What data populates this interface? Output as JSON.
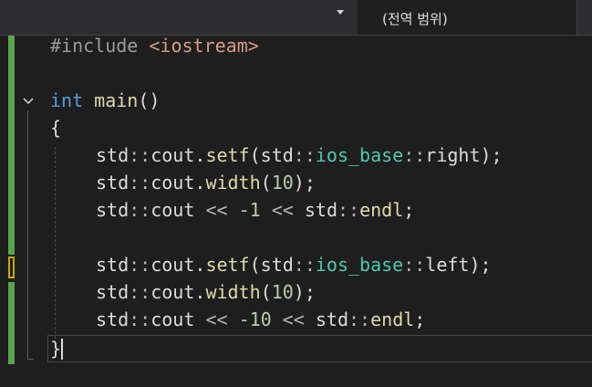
{
  "toolbar": {
    "scope": "(전역 범위)"
  },
  "code": {
    "l1": {
      "pre": "#include",
      "sp": " ",
      "inc": "<iostream>"
    },
    "l3": {
      "kw": "int",
      "sp": " ",
      "fn": "main",
      "rest": "()"
    },
    "l4": {
      "brace": "{"
    },
    "l5": {
      "ns1": "std",
      "op1": "::",
      "var1": "cout",
      "dot": ".",
      "fn": "setf",
      "p1": "(",
      "ns2": "std",
      "op2": "::",
      "ty": "ios_base",
      "op3": "::",
      "id": "right",
      "p2": ");"
    },
    "l6": {
      "ns1": "std",
      "op1": "::",
      "var1": "cout",
      "dot": ".",
      "fn": "width",
      "p1": "(",
      "num": "10",
      "p2": ");"
    },
    "l7": {
      "ns1": "std",
      "op1": "::",
      "var1": "cout",
      "sp1": " ",
      "op2": "<<",
      "sp2": " ",
      "num": "-1",
      "sp3": " ",
      "op3": "<<",
      "sp4": " ",
      "ns2": "std",
      "op4": "::",
      "fn": "endl",
      "p": ";"
    },
    "l9": {
      "ns1": "std",
      "op1": "::",
      "var1": "cout",
      "dot": ".",
      "fn": "setf",
      "p1": "(",
      "ns2": "std",
      "op2": "::",
      "ty": "ios_base",
      "op3": "::",
      "id": "left",
      "p2": ");"
    },
    "l10": {
      "ns1": "std",
      "op1": "::",
      "var1": "cout",
      "dot": ".",
      "fn": "width",
      "p1": "(",
      "num": "10",
      "p2": ");"
    },
    "l11": {
      "ns1": "std",
      "op1": "::",
      "var1": "cout",
      "sp1": " ",
      "op2": "<<",
      "sp2": " ",
      "num": "-10",
      "sp3": " ",
      "op3": "<<",
      "sp4": " ",
      "ns2": "std",
      "op4": "::",
      "fn": "endl",
      "p": ";"
    },
    "l12": {
      "brace": "}"
    }
  },
  "colors": {
    "change_saved": "#57a64a",
    "change_unsaved": "#cca700",
    "keyword": "#569cd6",
    "function": "#dcdcaa",
    "type": "#4ec9b0",
    "number": "#b5cea8",
    "include": "#d69d85"
  },
  "icons": {
    "dropdown": "chevron-down-icon",
    "fold": "collapse-chevron-icon"
  }
}
